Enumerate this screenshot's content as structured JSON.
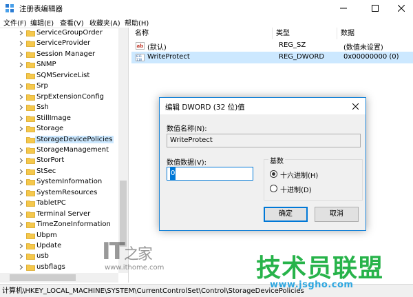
{
  "window": {
    "title": "注册表编辑器",
    "buttons": {
      "minimize": "minimize-icon",
      "maximize": "maximize-icon",
      "close": "close-icon"
    }
  },
  "menu": [
    "文件(F)",
    "编辑(E)",
    "查看(V)",
    "收藏夹(A)",
    "帮助(H)"
  ],
  "tree": {
    "items": [
      {
        "label": "ServiceGroupOrder",
        "expandable": true
      },
      {
        "label": "ServiceProvider",
        "expandable": true
      },
      {
        "label": "Session Manager",
        "expandable": true
      },
      {
        "label": "SNMP",
        "expandable": true
      },
      {
        "label": "SQMServiceList",
        "expandable": false
      },
      {
        "label": "Srp",
        "expandable": true
      },
      {
        "label": "SrpExtensionConfig",
        "expandable": true
      },
      {
        "label": "Ssh",
        "expandable": true
      },
      {
        "label": "StillImage",
        "expandable": true
      },
      {
        "label": "Storage",
        "expandable": true
      },
      {
        "label": "StorageDevicePolicies",
        "expandable": false,
        "selected": true
      },
      {
        "label": "StorageManagement",
        "expandable": true
      },
      {
        "label": "StorPort",
        "expandable": true
      },
      {
        "label": "StSec",
        "expandable": true
      },
      {
        "label": "SystemInformation",
        "expandable": true
      },
      {
        "label": "SystemResources",
        "expandable": true
      },
      {
        "label": "TabletPC",
        "expandable": true
      },
      {
        "label": "Terminal Server",
        "expandable": true
      },
      {
        "label": "TimeZoneInformation",
        "expandable": true
      },
      {
        "label": "Ubpm",
        "expandable": false
      },
      {
        "label": "Update",
        "expandable": true
      },
      {
        "label": "usb",
        "expandable": true
      },
      {
        "label": "usbflags",
        "expandable": true
      }
    ]
  },
  "values": {
    "columns": [
      "名称",
      "类型",
      "数据"
    ],
    "rows": [
      {
        "icon": "string-value-icon",
        "name": "(默认)",
        "type": "REG_SZ",
        "data": "(数值未设置)",
        "selected": false
      },
      {
        "icon": "binary-value-icon",
        "name": "WriteProtect",
        "type": "REG_DWORD",
        "data": "0x00000000 (0)",
        "selected": true
      }
    ]
  },
  "status": {
    "path": "计算机\\HKEY_LOCAL_MACHINE\\SYSTEM\\CurrentControlSet\\Control\\StorageDevicePolicies"
  },
  "dialog": {
    "title": "编辑 DWORD (32 位)值",
    "name_label": "数值名称(N):",
    "name_value": "WriteProtect",
    "data_label": "数值数据(V):",
    "data_value": "0",
    "base_label": "基数",
    "radios": [
      {
        "label": "十六进制(H)",
        "checked": true
      },
      {
        "label": "十进制(D)",
        "checked": false
      }
    ],
    "ok_label": "确定",
    "cancel_label": "取消"
  },
  "watermarks": {
    "it_logo": "IT之家",
    "ithome_url": "www.ithome.com",
    "jsgho_text": "技术员联盟",
    "jsgho_url": "www.jsgho.com"
  },
  "colors": {
    "accent": "#0078d7",
    "selection": "#cce8ff",
    "folder": "#f5c84c",
    "watermark_green": "#27b34a",
    "watermark_blue": "#2ea7e0"
  }
}
